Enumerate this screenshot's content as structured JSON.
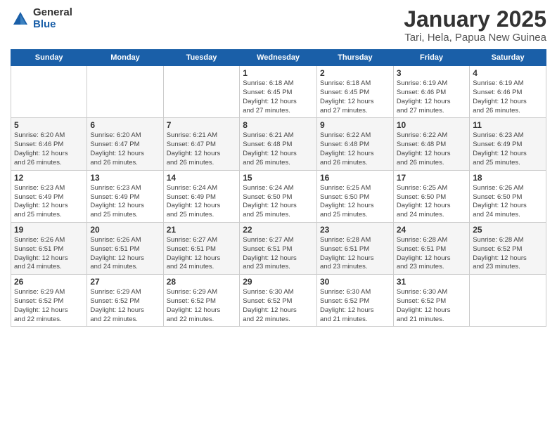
{
  "logo": {
    "general": "General",
    "blue": "Blue"
  },
  "header": {
    "title": "January 2025",
    "subtitle": "Tari, Hela, Papua New Guinea"
  },
  "weekdays": [
    "Sunday",
    "Monday",
    "Tuesday",
    "Wednesday",
    "Thursday",
    "Friday",
    "Saturday"
  ],
  "weeks": [
    [
      {
        "day": "",
        "info": ""
      },
      {
        "day": "",
        "info": ""
      },
      {
        "day": "",
        "info": ""
      },
      {
        "day": "1",
        "info": "Sunrise: 6:18 AM\nSunset: 6:45 PM\nDaylight: 12 hours\nand 27 minutes."
      },
      {
        "day": "2",
        "info": "Sunrise: 6:18 AM\nSunset: 6:45 PM\nDaylight: 12 hours\nand 27 minutes."
      },
      {
        "day": "3",
        "info": "Sunrise: 6:19 AM\nSunset: 6:46 PM\nDaylight: 12 hours\nand 27 minutes."
      },
      {
        "day": "4",
        "info": "Sunrise: 6:19 AM\nSunset: 6:46 PM\nDaylight: 12 hours\nand 26 minutes."
      }
    ],
    [
      {
        "day": "5",
        "info": "Sunrise: 6:20 AM\nSunset: 6:46 PM\nDaylight: 12 hours\nand 26 minutes."
      },
      {
        "day": "6",
        "info": "Sunrise: 6:20 AM\nSunset: 6:47 PM\nDaylight: 12 hours\nand 26 minutes."
      },
      {
        "day": "7",
        "info": "Sunrise: 6:21 AM\nSunset: 6:47 PM\nDaylight: 12 hours\nand 26 minutes."
      },
      {
        "day": "8",
        "info": "Sunrise: 6:21 AM\nSunset: 6:48 PM\nDaylight: 12 hours\nand 26 minutes."
      },
      {
        "day": "9",
        "info": "Sunrise: 6:22 AM\nSunset: 6:48 PM\nDaylight: 12 hours\nand 26 minutes."
      },
      {
        "day": "10",
        "info": "Sunrise: 6:22 AM\nSunset: 6:48 PM\nDaylight: 12 hours\nand 26 minutes."
      },
      {
        "day": "11",
        "info": "Sunrise: 6:23 AM\nSunset: 6:49 PM\nDaylight: 12 hours\nand 25 minutes."
      }
    ],
    [
      {
        "day": "12",
        "info": "Sunrise: 6:23 AM\nSunset: 6:49 PM\nDaylight: 12 hours\nand 25 minutes."
      },
      {
        "day": "13",
        "info": "Sunrise: 6:23 AM\nSunset: 6:49 PM\nDaylight: 12 hours\nand 25 minutes."
      },
      {
        "day": "14",
        "info": "Sunrise: 6:24 AM\nSunset: 6:49 PM\nDaylight: 12 hours\nand 25 minutes."
      },
      {
        "day": "15",
        "info": "Sunrise: 6:24 AM\nSunset: 6:50 PM\nDaylight: 12 hours\nand 25 minutes."
      },
      {
        "day": "16",
        "info": "Sunrise: 6:25 AM\nSunset: 6:50 PM\nDaylight: 12 hours\nand 25 minutes."
      },
      {
        "day": "17",
        "info": "Sunrise: 6:25 AM\nSunset: 6:50 PM\nDaylight: 12 hours\nand 24 minutes."
      },
      {
        "day": "18",
        "info": "Sunrise: 6:26 AM\nSunset: 6:50 PM\nDaylight: 12 hours\nand 24 minutes."
      }
    ],
    [
      {
        "day": "19",
        "info": "Sunrise: 6:26 AM\nSunset: 6:51 PM\nDaylight: 12 hours\nand 24 minutes."
      },
      {
        "day": "20",
        "info": "Sunrise: 6:26 AM\nSunset: 6:51 PM\nDaylight: 12 hours\nand 24 minutes."
      },
      {
        "day": "21",
        "info": "Sunrise: 6:27 AM\nSunset: 6:51 PM\nDaylight: 12 hours\nand 24 minutes."
      },
      {
        "day": "22",
        "info": "Sunrise: 6:27 AM\nSunset: 6:51 PM\nDaylight: 12 hours\nand 23 minutes."
      },
      {
        "day": "23",
        "info": "Sunrise: 6:28 AM\nSunset: 6:51 PM\nDaylight: 12 hours\nand 23 minutes."
      },
      {
        "day": "24",
        "info": "Sunrise: 6:28 AM\nSunset: 6:51 PM\nDaylight: 12 hours\nand 23 minutes."
      },
      {
        "day": "25",
        "info": "Sunrise: 6:28 AM\nSunset: 6:52 PM\nDaylight: 12 hours\nand 23 minutes."
      }
    ],
    [
      {
        "day": "26",
        "info": "Sunrise: 6:29 AM\nSunset: 6:52 PM\nDaylight: 12 hours\nand 22 minutes."
      },
      {
        "day": "27",
        "info": "Sunrise: 6:29 AM\nSunset: 6:52 PM\nDaylight: 12 hours\nand 22 minutes."
      },
      {
        "day": "28",
        "info": "Sunrise: 6:29 AM\nSunset: 6:52 PM\nDaylight: 12 hours\nand 22 minutes."
      },
      {
        "day": "29",
        "info": "Sunrise: 6:30 AM\nSunset: 6:52 PM\nDaylight: 12 hours\nand 22 minutes."
      },
      {
        "day": "30",
        "info": "Sunrise: 6:30 AM\nSunset: 6:52 PM\nDaylight: 12 hours\nand 21 minutes."
      },
      {
        "day": "31",
        "info": "Sunrise: 6:30 AM\nSunset: 6:52 PM\nDaylight: 12 hours\nand 21 minutes."
      },
      {
        "day": "",
        "info": ""
      }
    ]
  ]
}
